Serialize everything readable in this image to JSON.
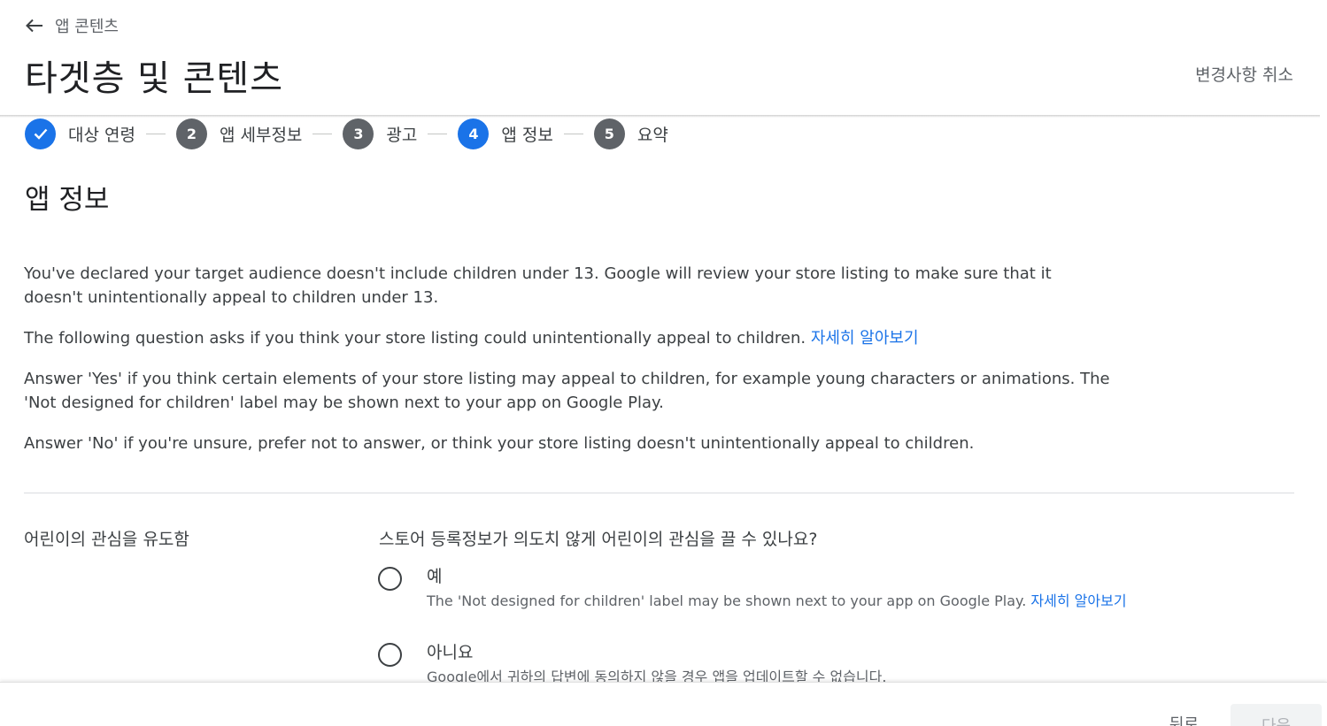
{
  "header": {
    "back_label": "앱 콘텐츠",
    "title": "타겟층 및 콘텐츠",
    "discard_label": "변경사항 취소"
  },
  "stepper": {
    "steps": [
      {
        "number": "",
        "label": "대상 연령",
        "state": "done"
      },
      {
        "number": "2",
        "label": "앱 세부정보",
        "state": "todo"
      },
      {
        "number": "3",
        "label": "광고",
        "state": "todo"
      },
      {
        "number": "4",
        "label": "앱 정보",
        "state": "active"
      },
      {
        "number": "5",
        "label": "요약",
        "state": "todo"
      }
    ]
  },
  "section": {
    "title": "앱 정보",
    "para1": "You've declared your target audience doesn't include children under 13. Google will review your store listing to make sure that it doesn't unintentionally appeal to children under 13.",
    "para2": "The following question asks if you think your store listing could unintentionally appeal to children.",
    "para2_link": "자세히 알아보기",
    "para3": "Answer 'Yes' if you think certain elements of your store listing may appeal to children, for example young characters or animations. The 'Not designed for children' label may be shown next to your app on Google Play.",
    "para4": "Answer 'No' if you're unsure, prefer not to answer, or think your store listing doesn't unintentionally appeal to children."
  },
  "question": {
    "field_label": "어린이의 관심을 유도함",
    "text": "스토어 등록정보가 의도치 않게 어린이의 관심을 끌 수 있나요?",
    "options": {
      "yes": {
        "label": "예",
        "desc": "The 'Not designed for children' label may be shown next to your app on Google Play.",
        "link": "자세히 알아보기"
      },
      "no": {
        "label": "아니요",
        "desc": "Google에서 귀하의 답변에 동의하지 않을 경우 앱을 업데이트할 수 없습니다."
      }
    }
  },
  "footer": {
    "back_label": "뒤로",
    "next_label": "다음"
  },
  "colors": {
    "accent": "#1a73e8",
    "step_inactive": "#5f6368"
  }
}
